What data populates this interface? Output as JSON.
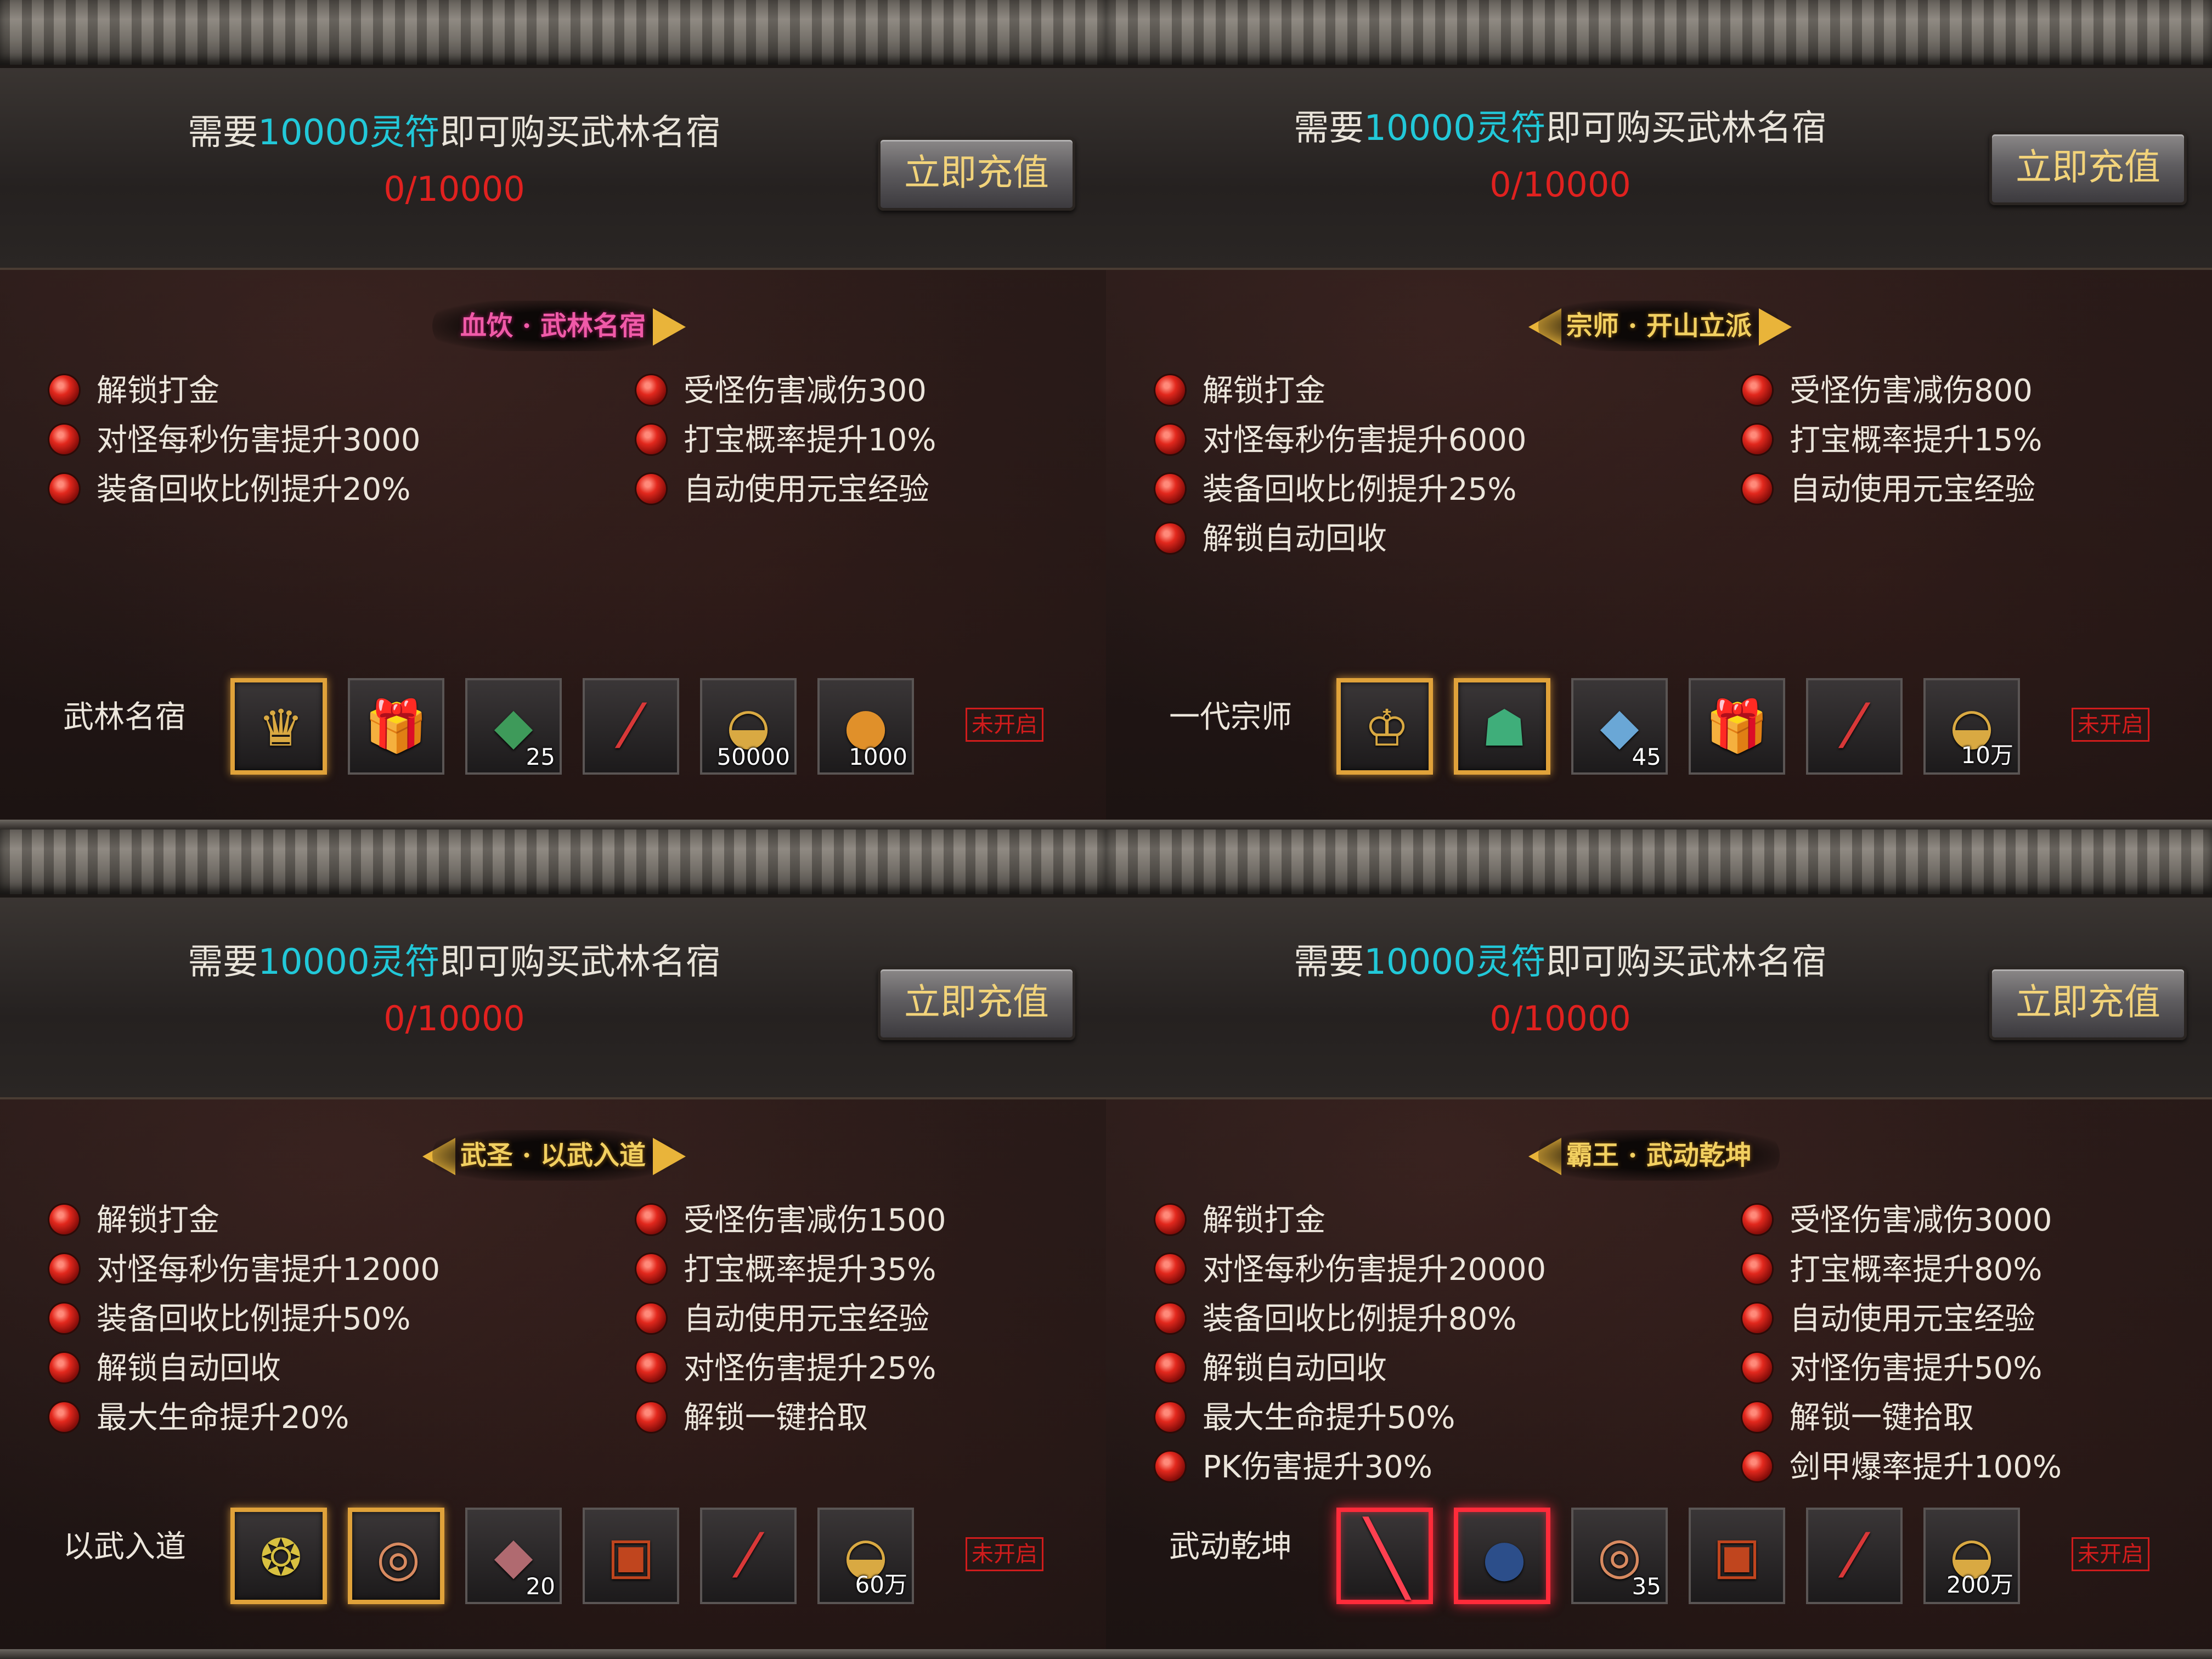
{
  "panels": [
    {
      "requirement": {
        "prefix": "需要",
        "highlight": "10000灵符",
        "suffix": "即可购买武林名宿"
      },
      "progress": "0/10000",
      "recharge_button": "立即充值",
      "title": "血饮 · 武林名宿",
      "title_color": "pink",
      "arrow_left": false,
      "arrow_right": true,
      "left_attrs": [
        "解锁打金",
        "对怪每秒伤害提升3000",
        "装备回收比例提升20%"
      ],
      "right_attrs": [
        "受怪伤害减伤300",
        "打宝概率提升10%",
        "自动使用元宝经验"
      ],
      "rank_label": "武林名宿",
      "rewards": [
        {
          "icon": "mask-icon",
          "glyph": "♛",
          "qty": "",
          "frame": "gold"
        },
        {
          "icon": "gift-box-icon",
          "glyph": "🎁",
          "qty": "",
          "frame": "none"
        },
        {
          "icon": "green-gem-icon",
          "glyph": "◆",
          "qty": "25",
          "frame": "none"
        },
        {
          "icon": "scroll-icon",
          "glyph": "⁄",
          "qty": "",
          "frame": "none"
        },
        {
          "icon": "gold-ingot-icon",
          "glyph": "◒",
          "qty": "50000",
          "frame": "none"
        },
        {
          "icon": "potion-gourd-icon",
          "glyph": "●",
          "qty": "1000",
          "frame": "none"
        }
      ],
      "status": "未开启"
    },
    {
      "requirement": {
        "prefix": "需要",
        "highlight": "10000灵符",
        "suffix": "即可购买武林名宿"
      },
      "progress": "0/10000",
      "recharge_button": "立即充值",
      "title": "宗师 · 开山立派",
      "title_color": "gold",
      "arrow_left": true,
      "arrow_right": true,
      "left_attrs": [
        "解锁打金",
        "对怪每秒伤害提升6000",
        "装备回收比例提升25%",
        "解锁自动回收"
      ],
      "right_attrs": [
        "受怪伤害减伤800",
        "打宝概率提升15%",
        "自动使用元宝经验"
      ],
      "rank_label": "一代宗师",
      "rewards": [
        {
          "icon": "crown-icon",
          "glyph": "♔",
          "qty": "",
          "frame": "gold"
        },
        {
          "icon": "demon-mask-icon",
          "glyph": "☗",
          "qty": "",
          "frame": "gold"
        },
        {
          "icon": "blue-gem-icon",
          "glyph": "◆",
          "qty": "45",
          "frame": "none"
        },
        {
          "icon": "gift-box-icon",
          "glyph": "🎁",
          "qty": "",
          "frame": "none"
        },
        {
          "icon": "scroll-icon",
          "glyph": "⁄",
          "qty": "",
          "frame": "none"
        },
        {
          "icon": "gold-ingot-icon",
          "glyph": "◒",
          "qty": "10万",
          "frame": "none"
        }
      ],
      "status": "未开启"
    },
    {
      "requirement": {
        "prefix": "需要",
        "highlight": "10000灵符",
        "suffix": "即可购买武林名宿"
      },
      "progress": "0/10000",
      "recharge_button": "立即充值",
      "title": "武圣 · 以武入道",
      "title_color": "gold",
      "arrow_left": true,
      "arrow_right": true,
      "left_attrs": [
        "解锁打金",
        "对怪每秒伤害提升12000",
        "装备回收比例提升50%",
        "解锁自动回收",
        "最大生命提升20%"
      ],
      "right_attrs": [
        "受怪伤害减伤1500",
        "打宝概率提升35%",
        "自动使用元宝经验",
        "对怪伤害提升25%",
        "解锁一键拾取"
      ],
      "rank_label": "以武入道",
      "rewards": [
        {
          "icon": "amulet-icon",
          "glyph": "❂",
          "qty": "",
          "frame": "gold"
        },
        {
          "icon": "ring-icon",
          "glyph": "◎",
          "qty": "",
          "frame": "gold"
        },
        {
          "icon": "red-gem-icon",
          "glyph": "◆",
          "qty": "20",
          "frame": "none"
        },
        {
          "icon": "treasure-chest-icon",
          "glyph": "▣",
          "qty": "",
          "frame": "none"
        },
        {
          "icon": "scroll-icon",
          "glyph": "⁄",
          "qty": "",
          "frame": "none"
        },
        {
          "icon": "gold-ingot-icon",
          "glyph": "◒",
          "qty": "60万",
          "frame": "none"
        }
      ],
      "status": "未开启"
    },
    {
      "requirement": {
        "prefix": "需要",
        "highlight": "10000灵符",
        "suffix": "即可购买武林名宿"
      },
      "progress": "0/10000",
      "recharge_button": "立即充值",
      "title": "霸王 · 武动乾坤",
      "title_color": "gold",
      "arrow_left": true,
      "arrow_right": false,
      "left_attrs": [
        "解锁打金",
        "对怪每秒伤害提升20000",
        "装备回收比例提升80%",
        "解锁自动回收",
        "最大生命提升50%",
        "PK伤害提升30%"
      ],
      "right_attrs": [
        "受怪伤害减伤3000",
        "打宝概率提升80%",
        "自动使用元宝经验",
        "对怪伤害提升50%",
        "解锁一键拾取",
        "剑甲爆率提升100%"
      ],
      "rank_label": "武动乾坤",
      "rewards": [
        {
          "icon": "red-blade-icon",
          "glyph": "╲",
          "qty": "",
          "frame": "red"
        },
        {
          "icon": "dark-orb-icon",
          "glyph": "●",
          "qty": "",
          "frame": "red"
        },
        {
          "icon": "red-ring-icon",
          "glyph": "◎",
          "qty": "35",
          "frame": "none"
        },
        {
          "icon": "treasure-chest-icon",
          "glyph": "▣",
          "qty": "",
          "frame": "none"
        },
        {
          "icon": "scroll-icon",
          "glyph": "⁄",
          "qty": "",
          "frame": "none"
        },
        {
          "icon": "gold-ingot-icon",
          "glyph": "◒",
          "qty": "200万",
          "frame": "none"
        }
      ],
      "status": "未开启"
    }
  ],
  "colors": {
    "highlight_cyan": "#22c8d8",
    "progress_red": "#e0211f",
    "status_red": "#d01c1c",
    "gold_frame": "#e0a23a",
    "red_frame": "#ff2b3a"
  }
}
